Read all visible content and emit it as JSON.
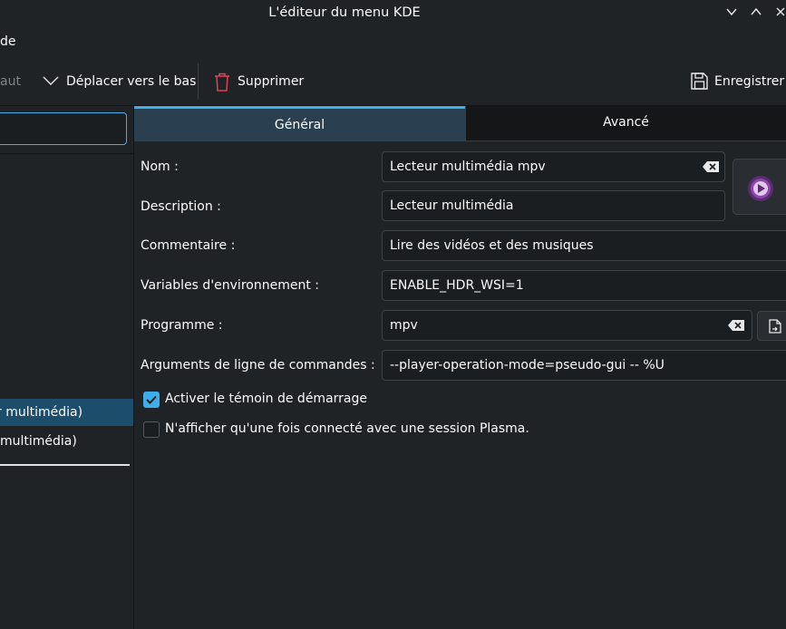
{
  "window": {
    "title": "L'éditeur du menu KDE"
  },
  "menubar": {
    "item_aide": "de"
  },
  "toolbar": {
    "move_up_partial": "aut",
    "move_down": "Déplacer vers le bas",
    "delete": "Supprimer",
    "save": "Enregistrer"
  },
  "tree": {
    "items": [
      {
        "label": "r multimédia)",
        "selected": true
      },
      {
        "label": " multimédia)",
        "selected": false
      }
    ]
  },
  "tabs": [
    {
      "label": "Général",
      "active": true
    },
    {
      "label": "Avancé",
      "active": false
    }
  ],
  "form": {
    "name_label": "Nom :",
    "name_value": "Lecteur multimédia mpv",
    "description_label": "Description :",
    "description_value": "Lecteur multimédia",
    "comment_label": "Commentaire :",
    "comment_value": "Lire des vidéos et des musiques",
    "env_label": "Variables d'environnement :",
    "env_value": "ENABLE_HDR_WSI=1",
    "program_label": "Programme :",
    "program_value": "mpv",
    "args_label": "Arguments de ligne de commandes :",
    "args_value": "--player-operation-mode=pseudo-gui -- %U",
    "startup_notify_label": "Activer le témoin de démarrage",
    "startup_notify_checked": true,
    "plasma_only_label": "N'afficher qu'une fois connecté avec une session Plasma.",
    "plasma_only_checked": false
  },
  "colors": {
    "accent": "#3daee9",
    "background": "#202326",
    "selection": "#1c4e6c",
    "delete_icon": "#da4453",
    "mpv_icon": "#8e44ad"
  }
}
